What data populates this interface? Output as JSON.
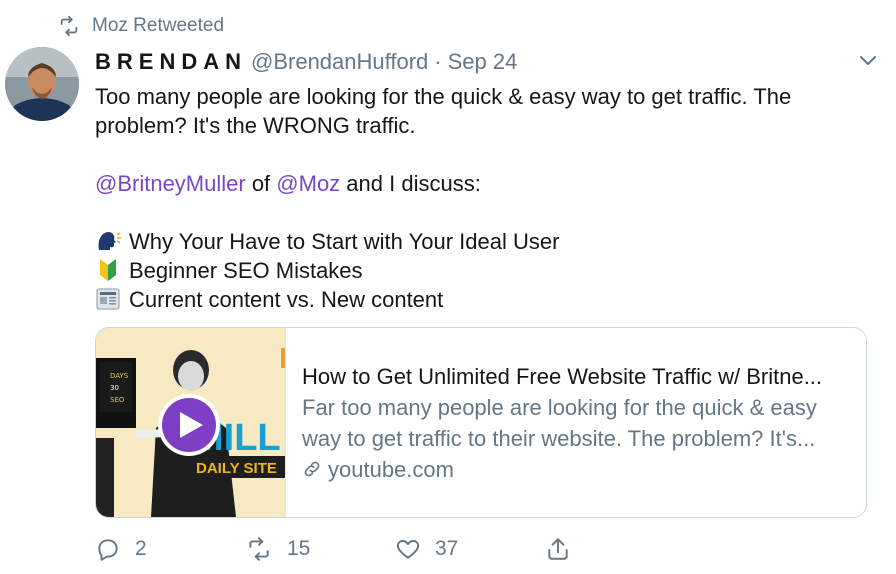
{
  "retweet_banner": {
    "icon": "retweet-icon",
    "text": "Moz Retweeted"
  },
  "tweet": {
    "author_name": "BRENDAN",
    "handle": "@BrendanHufford",
    "separator": "·",
    "date": "Sep 24",
    "lines": {
      "l1": "Too many people are looking for the quick & easy way to get traffic. The",
      "l2": "problem? It's the WRONG traffic.",
      "mention1": "@BritneyMuller",
      "of": " of ",
      "mention2": "@Moz",
      "discuss": " and I discuss:",
      "b1": "Why Your Have to Start with Your Ideal User",
      "b2": "Beginner SEO Mistakes",
      "b3": "Current content vs. New content"
    }
  },
  "card": {
    "title": "How to Get Unlimited Free Website Traffic w/ Britne...",
    "desc1": "Far too many people are looking for the quick & easy",
    "desc2": "way to get traffic to their website. The problem? It's...",
    "domain": "youtube.com",
    "thumb_text_top": "MILL",
    "thumb_text_bottom": "DAILY SITE"
  },
  "actions": {
    "replies": "2",
    "retweets": "15",
    "likes": "37"
  },
  "colors": {
    "mention": "#7b46c9",
    "muted": "#657786",
    "play": "#7e3fc4"
  }
}
